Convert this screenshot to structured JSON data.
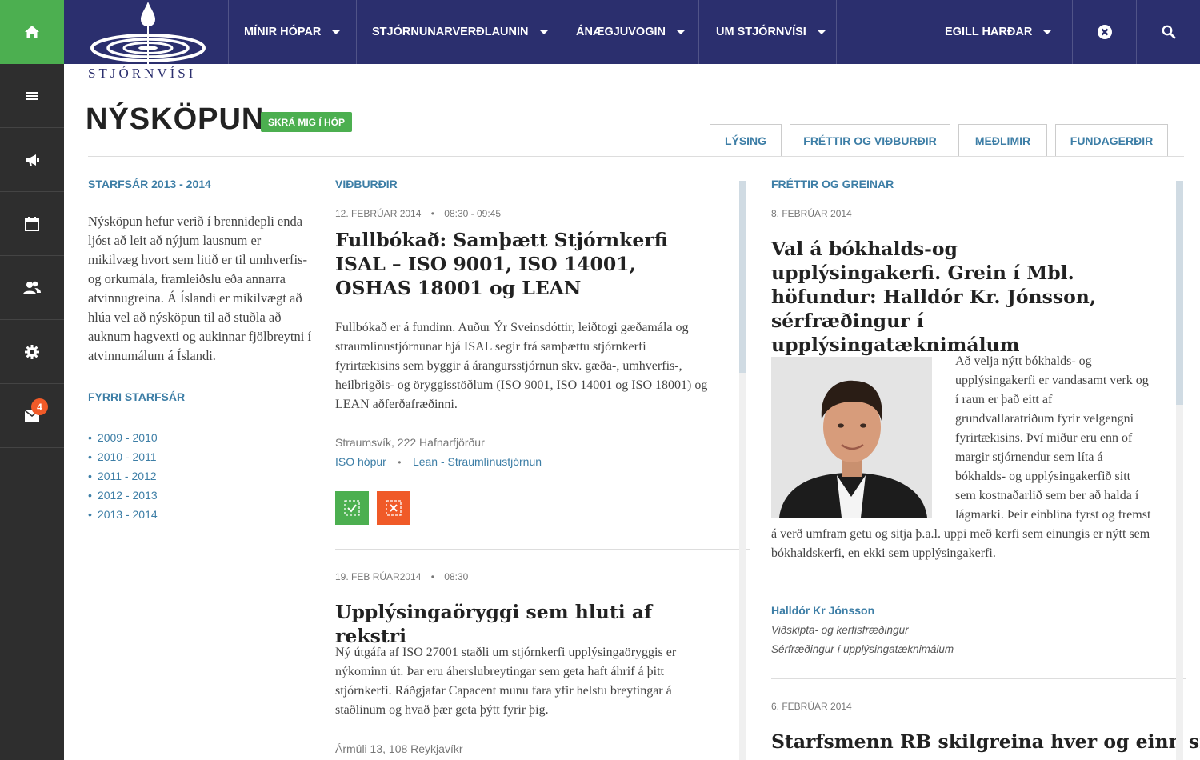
{
  "brand": {
    "logo_text": "STJÓRNVÍSI"
  },
  "colors": {
    "navy": "#2b2f6e",
    "green": "#4caf50",
    "orange": "#f05a28",
    "link": "#3d7ea6",
    "sidebar": "#2e2e2e"
  },
  "topnav": {
    "items": [
      {
        "label": "MÍNIR HÓPAR"
      },
      {
        "label": "STJÓRNUNARVERÐLAUNIN"
      },
      {
        "label": "ÁNÆGJUVOGIN"
      },
      {
        "label": "UM STJÓRNVÍSI"
      }
    ],
    "user_label": "EGILL HARÐAR",
    "icons": [
      "home-icon",
      "close-circle-icon",
      "search-icon"
    ]
  },
  "sidebar": {
    "items": [
      {
        "icon": "menu-icon"
      },
      {
        "icon": "megaphone-icon"
      },
      {
        "icon": "calendar-icon"
      },
      {
        "icon": "users-icon"
      },
      {
        "icon": "gear-icon"
      },
      {
        "icon": "mail-icon",
        "badge": "4"
      }
    ]
  },
  "header": {
    "title": "NÝSKÖPUN",
    "join_label": "SKRÁ MIG Í HÓP",
    "tabs": [
      {
        "label": "LÝSING"
      },
      {
        "label": "FRÉTTIR OG VIÐBURÐIR"
      },
      {
        "label": "MEÐLIMIR"
      },
      {
        "label": "FUNDAGERÐIR"
      }
    ]
  },
  "left": {
    "section_label": "STARFSÁR 2013 - 2014",
    "body": "Nýsköpun hefur verið í brennidepli enda ljóst að leit að nýjum lausnum er mikilvæg hvort sem litið er til umhverfis- og orkumála, framleiðslu eða annarra atvinnugreina. Á Íslandi er mikilvægt að hlúa vel að nýsköpun til að stuðla að auknum hagvexti og aukinnar fjölbreytni í atvinnumálum á Íslandi.",
    "prev_label": "FYRRI STARFSÁR",
    "years": [
      "2009 - 2010",
      "2010 - 2011",
      "2011 - 2012",
      "2012 - 2013",
      "2013 - 2014"
    ]
  },
  "events": {
    "section_label": "VIÐBURÐIR",
    "items": [
      {
        "date": "12. FEBRÚAR 2014",
        "time": "08:30 - 09:45",
        "title": "Fullbókað: Samþætt Stjórnkerfi ISAL – ISO 9001, ISO 14001, OSHAS 18001 og LEAN",
        "body": "Fullbókað er á fundinn. Auður Ýr Sveinsdóttir, leiðtogi gæðamála og straumlínustjórnunar hjá ISAL segir frá samþættu stjórnkerfi fyrirtækisins sem byggir á árangursstjórnun skv. gæða-, umhverfis-, heilbrigðis- og öryggisstöðlum (ISO 9001, ISO 14001 og ISO 18001) og LEAN aðferðafræðinni.",
        "location": "Straumsvík, 222 Hafnarfjörður",
        "tag1": "ISO hópur",
        "tag2": "Lean - Straumlínustjórnun"
      },
      {
        "date": "19. FEB RÚAR2014",
        "time": "08:30",
        "title": "Upplýsingaöryggi sem hluti af rekstri",
        "body": "Ný útgáfa af ISO 27001 staðli um stjórnkerfi upplýsingaöryggis er nýkominn út. Þar eru áherslubreytingar sem geta haft áhrif á þitt stjórnkerfi. Ráðgjafar Capacent munu fara yfir helstu breytingar á staðlinum og hvað þær geta þýtt fyrir þig.",
        "location": "Ármúli 13, 108 Reykjavíkr"
      }
    ]
  },
  "news": {
    "section_label": "FRÉTTIR OG GREINAR",
    "items": [
      {
        "date": "8. FEBRÚAR 2014",
        "title": "Val á bókhalds-og upplýsingakerfi. Grein í Mbl. höfundur: Halldór Kr. Jónsson, sérfræðingur í upplýsingatæknimálum",
        "body": "Að velja nýtt bókhalds- og upplýsingakerfi er vandasamt verk og í raun er það eitt af grundvallaratriðum fyrir velgengni fyrirtækisins. Því miður eru enn of margir stjórnendur sem líta á bókhalds- og upplýsingakerfið sitt sem kostnaðarlið sem ber að halda í lágmarki. Þeir einblína fyrst og fremst á verð umfram getu og sitja þ.a.l. uppi með kerfi sem einungis er nýtt sem bókhaldskerfi, en ekki sem upplýsingakerfi.",
        "author": "Halldór Kr Jónsson",
        "role1": "Viðskipta- og kerfisfræðingur",
        "role2": "Sérfræðingur í upplýsingatæknimálum"
      },
      {
        "date": "6. FEBRÚAR 2014",
        "title": "Starfsmenn RB skilgreina hver og einn sitt"
      }
    ]
  }
}
